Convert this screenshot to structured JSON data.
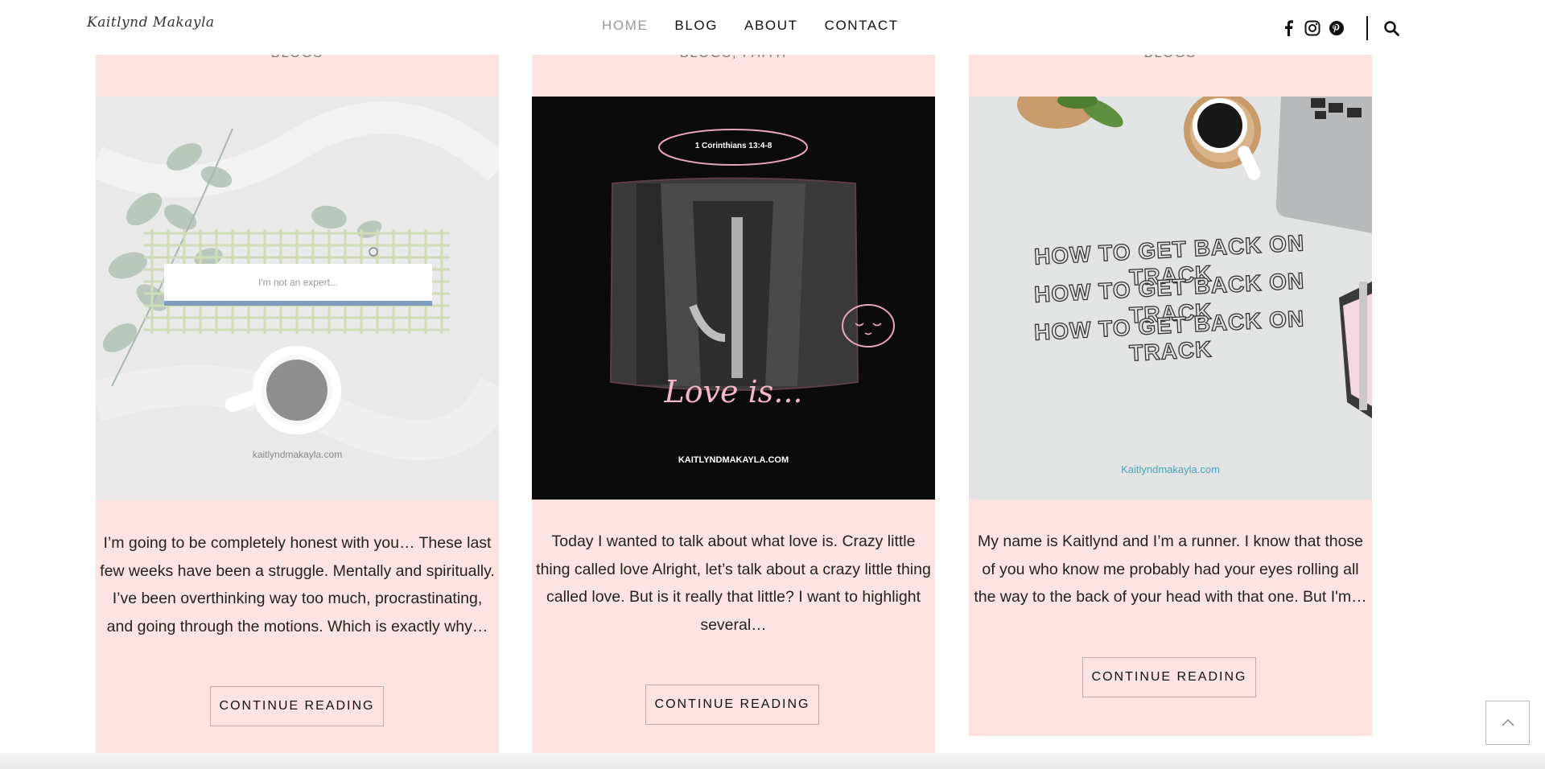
{
  "header": {
    "logo": "Kaitlynd Makayla",
    "nav": [
      "HOME",
      "BLOG",
      "ABOUT",
      "CONTACT"
    ],
    "active_nav": "HOME",
    "social_icons": [
      "facebook-icon",
      "instagram-icon",
      "pinterest-icon"
    ],
    "search_icon": "search-icon"
  },
  "cards": [
    {
      "category": "BLOGS",
      "image": {
        "search_placeholder": "I'm not an expert...",
        "watermark": "kaitlyndmakayla.com"
      },
      "excerpt": "I’m going to be completely honest with you…  These last few weeks have been a struggle. Mentally and spiritually. I’ve been overthinking way too much, procrastinating, and going through the motions. Which is exactly why…",
      "button": "CONTINUE READING"
    },
    {
      "category": "BLOGS, FAITH",
      "image": {
        "verse": "1 Corinthians 13:4-8",
        "script_text": "Love is...",
        "watermark": "KAITLYNDMAKAYLA.COM"
      },
      "excerpt": "Today I wanted to talk about what love is. Crazy little thing called love Alright, let’s talk about a crazy little thing called love. But is it really that little? I want to highlight several…",
      "button": "CONTINUE READING"
    },
    {
      "category": "BLOGS",
      "image": {
        "headline": "HOW TO GET BACK ON TRACK",
        "watermark": "Kaitlyndmakayla.com"
      },
      "excerpt": "My name is Kaitlynd and I’m a runner.  I know that those of you who know me probably had your eyes rolling all the way to the back of your head with that one. But I'm…",
      "button": "CONTINUE READING"
    }
  ],
  "colors": {
    "card_bg": "#fde4e2",
    "nav_active": "#999999",
    "accent_pink": "#e9a7b8"
  }
}
